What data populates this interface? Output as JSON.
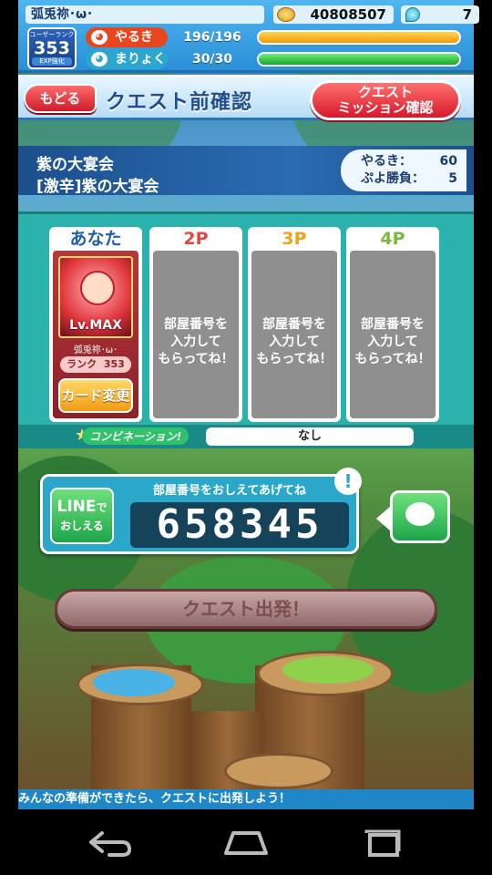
{
  "status": {
    "player_name": "弧兎祢･ω･",
    "coins": "40808507",
    "gems": "7",
    "rank_caption": "ユーザーランク",
    "rank": "353",
    "exp_label": "EXP強化",
    "stamina_label": "やるき",
    "stamina_value": "196/196",
    "stamina_fraction": 1.0,
    "magic_label": "まりょく",
    "magic_value": "30/30",
    "magic_fraction": 1.0
  },
  "header": {
    "back_label": "もどる",
    "title": "クエスト前確認",
    "mission_line1": "クエスト",
    "mission_line2": "ミッション確認"
  },
  "quest": {
    "line1": "紫の大宴会",
    "line2": "[激辛]紫の大宴会",
    "stamina_label": "やるき：",
    "stamina_cost": "60",
    "wins_label": "ぷよ勝負：",
    "wins": "5"
  },
  "party": {
    "slots": [
      {
        "label": "あなた"
      },
      {
        "label": "2P",
        "message_line1": "部屋番号を",
        "message_line2": "入力して",
        "message_line3": "もらってね！"
      },
      {
        "label": "3P",
        "message_line1": "部屋番号を",
        "message_line2": "入力して",
        "message_line3": "もらってね！"
      },
      {
        "label": "4P",
        "message_line1": "部屋番号を",
        "message_line2": "入力して",
        "message_line3": "もらってね！"
      }
    ],
    "card_level": "Lv.MAX",
    "card_owner": "弧兎祢･ω･",
    "rank_label": "ランク",
    "rank_value": "353",
    "change_card_label": "カード変更"
  },
  "combination": {
    "label": "コンビネーション!",
    "value": "なし"
  },
  "room": {
    "line_label_top": "LINE",
    "line_label_small": "で",
    "line_label_bottom": "おしえる",
    "caption": "部屋番号をおしえてあげてね",
    "number": "658345",
    "bang": "!"
  },
  "depart_label": "クエスト出発！",
  "ticker": "みんなの準備ができたら、クエストに出発しよう！",
  "colors": {
    "accent_red": "#d6192b",
    "accent_blue": "#1f86c8",
    "panel_teal": "#2cb2ad",
    "line_green": "#1ea64a"
  }
}
